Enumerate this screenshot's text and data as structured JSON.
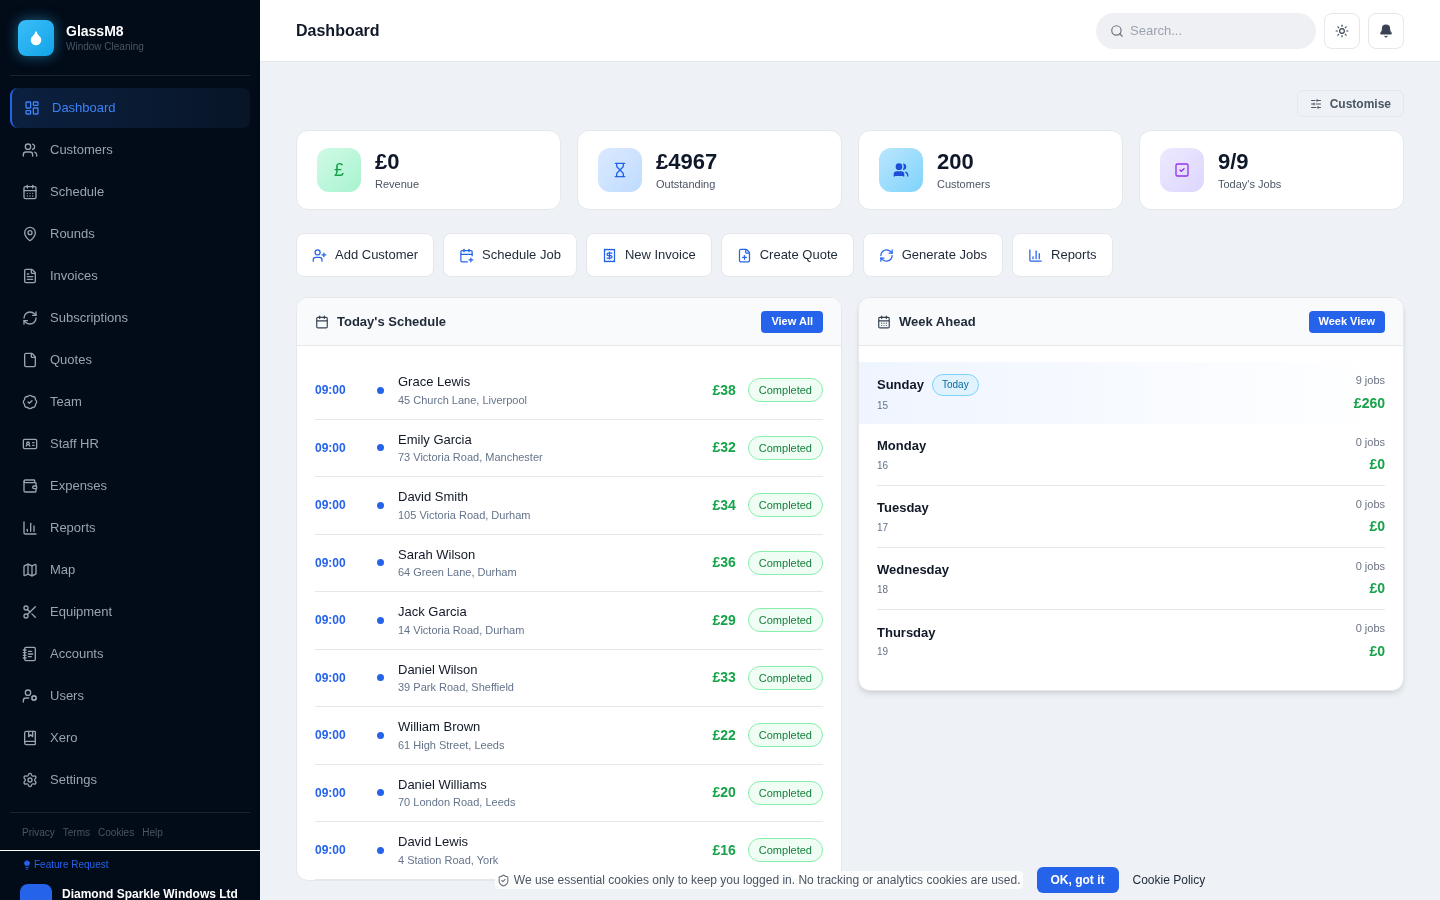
{
  "brand": {
    "name": "GlassM8",
    "tagline": "Window Cleaning"
  },
  "sidebar": {
    "items": [
      {
        "label": "Dashboard",
        "selected": true
      },
      {
        "label": "Customers",
        "selected": false
      },
      {
        "label": "Schedule",
        "selected": false
      },
      {
        "label": "Rounds",
        "selected": false
      },
      {
        "label": "Invoices",
        "selected": false
      },
      {
        "label": "Subscriptions",
        "selected": false
      },
      {
        "label": "Quotes",
        "selected": false
      },
      {
        "label": "Team",
        "selected": false
      },
      {
        "label": "Staff HR",
        "selected": false
      },
      {
        "label": "Expenses",
        "selected": false
      },
      {
        "label": "Reports",
        "selected": false
      },
      {
        "label": "Map",
        "selected": false
      },
      {
        "label": "Equipment",
        "selected": false
      },
      {
        "label": "Accounts",
        "selected": false
      },
      {
        "label": "Users",
        "selected": false
      },
      {
        "label": "Xero",
        "selected": false
      },
      {
        "label": "Settings",
        "selected": false
      }
    ],
    "footer_links": [
      "Privacy",
      "Terms",
      "Cookies",
      "Help"
    ],
    "feature_request": "Feature Request",
    "company": "Diamond Sparkle Windows Ltd"
  },
  "header": {
    "title": "Dashboard",
    "search": {
      "placeholder": "Search..."
    }
  },
  "customise": "Customise",
  "stats": [
    {
      "kind": "pound",
      "symbol": "£",
      "value": "£0",
      "label": "Revenue"
    },
    {
      "kind": "hourglass",
      "value": "£4967",
      "label": "Outstanding"
    },
    {
      "kind": "users",
      "value": "200",
      "label": "Customers"
    },
    {
      "kind": "check",
      "value": "9/9",
      "label": "Today's Jobs"
    }
  ],
  "actions": [
    "Add Customer",
    "Schedule Job",
    "New Invoice",
    "Create Quote",
    "Generate Jobs",
    "Reports"
  ],
  "schedule": {
    "title": "Today's Schedule",
    "button": "View All",
    "rows": [
      {
        "time": "09:00",
        "name": "Grace Lewis",
        "address": "45 Church Lane, Liverpool",
        "amount": "£38",
        "status": "Completed"
      },
      {
        "time": "09:00",
        "name": "Emily Garcia",
        "address": "73 Victoria Road, Manchester",
        "amount": "£32",
        "status": "Completed"
      },
      {
        "time": "09:00",
        "name": "David Smith",
        "address": "105 Victoria Road, Durham",
        "amount": "£34",
        "status": "Completed"
      },
      {
        "time": "09:00",
        "name": "Sarah Wilson",
        "address": "64 Green Lane, Durham",
        "amount": "£36",
        "status": "Completed"
      },
      {
        "time": "09:00",
        "name": "Jack Garcia",
        "address": "14 Victoria Road, Durham",
        "amount": "£29",
        "status": "Completed"
      },
      {
        "time": "09:00",
        "name": "Daniel Wilson",
        "address": "39 Park Road, Sheffield",
        "amount": "£33",
        "status": "Completed"
      },
      {
        "time": "09:00",
        "name": "William Brown",
        "address": "61 High Street, Leeds",
        "amount": "£22",
        "status": "Completed"
      },
      {
        "time": "09:00",
        "name": "Daniel Williams",
        "address": "70 London Road, Leeds",
        "amount": "£20",
        "status": "Completed"
      },
      {
        "time": "09:00",
        "name": "David Lewis",
        "address": "4 Station Road, York",
        "amount": "£16",
        "status": "Completed"
      }
    ]
  },
  "week": {
    "title": "Week Ahead",
    "button": "Week View",
    "days": [
      {
        "day": "Sunday",
        "date": "15",
        "badge": "Today",
        "selected": true,
        "jobs": "9 jobs",
        "amount": "£260"
      },
      {
        "day": "Monday",
        "date": "16",
        "selected": false,
        "jobs": "0 jobs",
        "amount": "£0"
      },
      {
        "day": "Tuesday",
        "date": "17",
        "selected": false,
        "jobs": "0 jobs",
        "amount": "£0"
      },
      {
        "day": "Wednesday",
        "date": "18",
        "selected": false,
        "jobs": "0 jobs",
        "amount": "£0"
      },
      {
        "day": "Thursday",
        "date": "19",
        "selected": false,
        "jobs": "0 jobs",
        "amount": "£0"
      }
    ]
  },
  "cookie_banner": {
    "text": "We use essential cookies only to keep you logged in. No tracking or analytics cookies are used.",
    "accept": "OK, got it",
    "policy": "Cookie Policy"
  }
}
